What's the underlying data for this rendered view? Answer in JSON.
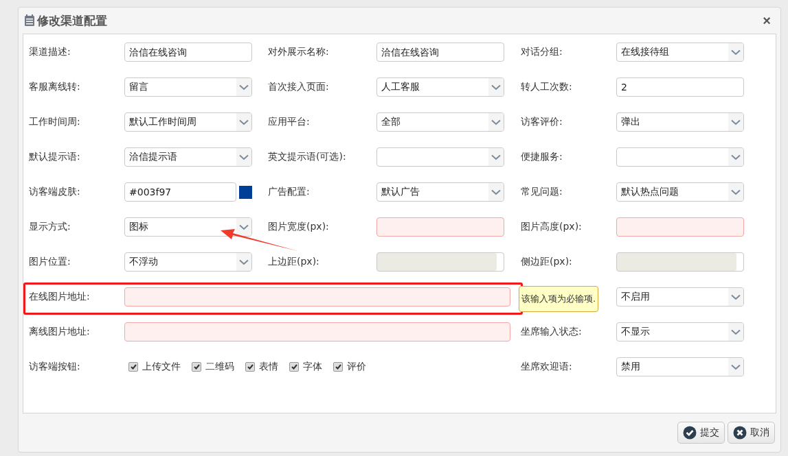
{
  "window": {
    "title": "修改渠道配置",
    "close": "×"
  },
  "rows": [
    {
      "highlighted": false,
      "items": [
        {
          "kind": "label",
          "text": "渠道描述:"
        },
        {
          "kind": "text",
          "value": "洽信在线咨询"
        },
        {
          "kind": "label",
          "text": "对外展示名称:"
        },
        {
          "kind": "text",
          "value": "洽信在线咨询"
        },
        {
          "kind": "label",
          "text": "对话分组:"
        },
        {
          "kind": "select",
          "value": "在线接待组"
        }
      ]
    },
    {
      "highlighted": false,
      "items": [
        {
          "kind": "label",
          "text": "客服离线转:"
        },
        {
          "kind": "select",
          "value": "留言"
        },
        {
          "kind": "label",
          "text": "首次接入页面:"
        },
        {
          "kind": "select",
          "value": "人工客服"
        },
        {
          "kind": "label",
          "text": "转人工次数:"
        },
        {
          "kind": "text",
          "value": "2"
        }
      ]
    },
    {
      "highlighted": false,
      "items": [
        {
          "kind": "label",
          "text": "工作时间周:"
        },
        {
          "kind": "select",
          "value": "默认工作时间周"
        },
        {
          "kind": "label",
          "text": "应用平台:"
        },
        {
          "kind": "select",
          "value": "全部"
        },
        {
          "kind": "label",
          "text": "访客评价:"
        },
        {
          "kind": "select",
          "value": "弹出"
        }
      ]
    },
    {
      "highlighted": false,
      "items": [
        {
          "kind": "label",
          "text": "默认提示语:"
        },
        {
          "kind": "select",
          "value": "洽信提示语"
        },
        {
          "kind": "label",
          "text": "英文提示语(可选):"
        },
        {
          "kind": "select"
        },
        {
          "kind": "label",
          "text": "便捷服务:"
        },
        {
          "kind": "select"
        }
      ]
    },
    {
      "highlighted": false,
      "items": [
        {
          "kind": "label",
          "text": "访客端皮肤:"
        },
        {
          "kind": "color",
          "value": "#003f97",
          "color": "#003f97"
        },
        {
          "kind": "label",
          "text": "广告配置:"
        },
        {
          "kind": "select",
          "value": "默认广告"
        },
        {
          "kind": "label",
          "text": "常见问题:"
        },
        {
          "kind": "select",
          "value": "默认热点问题"
        }
      ]
    },
    {
      "highlighted": false,
      "items": [
        {
          "kind": "label",
          "text": "显示方式:"
        },
        {
          "kind": "select",
          "value": "图标"
        },
        {
          "kind": "label",
          "text": "图片宽度(px):"
        },
        {
          "kind": "text",
          "invalid": true
        },
        {
          "kind": "label",
          "text": "图片高度(px):"
        },
        {
          "kind": "text",
          "invalid": true
        }
      ]
    },
    {
      "highlighted": false,
      "items": [
        {
          "kind": "label",
          "text": "图片位置:"
        },
        {
          "kind": "select",
          "value": "不浮动"
        },
        {
          "kind": "label",
          "text": "上边距(px):"
        },
        {
          "kind": "text",
          "disabled": true
        },
        {
          "kind": "label",
          "text": "侧边距(px):"
        },
        {
          "kind": "text",
          "disabled": true
        }
      ]
    },
    {
      "highlighted": true,
      "items": [
        {
          "kind": "label",
          "text": "在线图片地址:"
        },
        {
          "kind": "long-text",
          "invalid": true
        },
        {
          "kind": "tooltip",
          "text": "该输入项为必输项."
        },
        {
          "kind": "select",
          "value": "不启用"
        }
      ]
    },
    {
      "highlighted": false,
      "items": [
        {
          "kind": "label",
          "text": "离线图片地址:"
        },
        {
          "kind": "long-text",
          "invalid": true
        },
        {
          "kind": "label",
          "text": "坐席输入状态:"
        },
        {
          "kind": "select",
          "value": "不显示"
        }
      ]
    },
    {
      "highlighted": false,
      "items": [
        {
          "kind": "label",
          "text": "访客端按钮:"
        },
        {
          "kind": "checks",
          "options": [
            {
              "label": "上传文件",
              "checked": true
            },
            {
              "label": "二维码",
              "checked": true
            },
            {
              "label": "表情",
              "checked": true
            },
            {
              "label": "字体",
              "checked": true
            },
            {
              "label": "评价",
              "checked": true
            }
          ]
        },
        {
          "kind": "label",
          "text": "坐席欢迎语:"
        },
        {
          "kind": "select",
          "value": "禁用"
        }
      ]
    }
  ],
  "annotation_arrow": true,
  "buttons": [
    {
      "label": "提交",
      "kind": "submit"
    },
    {
      "label": "取消",
      "kind": "cancel"
    }
  ]
}
